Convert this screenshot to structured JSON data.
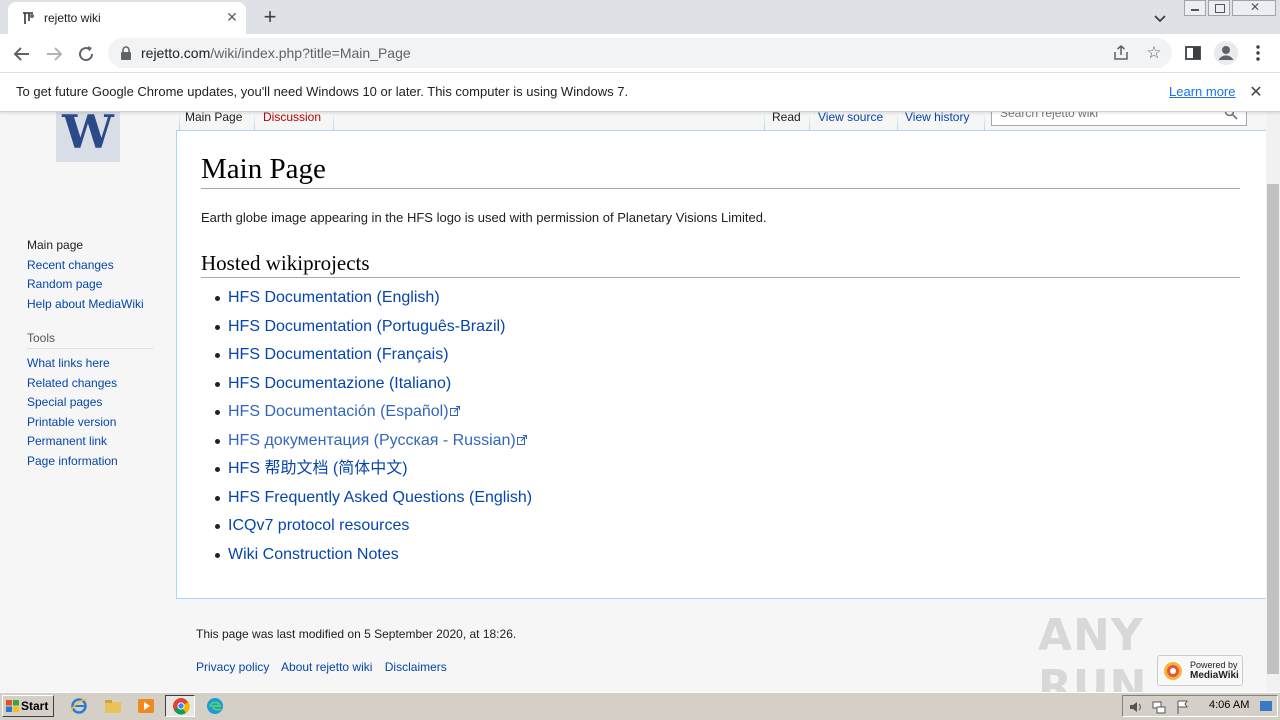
{
  "browser": {
    "tab_title": "rejetto wiki",
    "url_host": "rejetto.com",
    "url_path": "/wiki/index.php?title=Main_Page",
    "infobar_text": "To get future Google Chrome updates, you'll need Windows 10 or later. This computer is using Windows 7.",
    "infobar_link": "Learn more"
  },
  "wiki": {
    "tabs": {
      "main_page": "Main Page",
      "discussion": "Discussion",
      "read": "Read",
      "view_source": "View source",
      "view_history": "View history"
    },
    "search_placeholder": "Search rejetto wiki",
    "navigation": [
      "Main page",
      "Recent changes",
      "Random page",
      "Help about MediaWiki"
    ],
    "tools_heading": "Tools",
    "tools": [
      "What links here",
      "Related changes",
      "Special pages",
      "Printable version",
      "Permanent link",
      "Page information"
    ],
    "heading": "Main Page",
    "intro": "Earth globe image appearing in the HFS logo is used with permission of Planetary Visions Limited.",
    "section_heading": "Hosted wikiprojects",
    "projects": [
      {
        "label": "HFS Documentation (English)",
        "external": false
      },
      {
        "label": "HFS Documentation (Português-Brazil)",
        "external": false
      },
      {
        "label": "HFS Documentation (Français)",
        "external": false
      },
      {
        "label": "HFS Documentazione (Italiano)",
        "external": false
      },
      {
        "label": "HFS Documentación (Español)",
        "external": true
      },
      {
        "label": "HFS документация (Русская - Russian)",
        "external": true
      },
      {
        "label": "HFS 帮助文档 (简体中文)",
        "external": false
      },
      {
        "label": "HFS Frequently Asked Questions (English)",
        "external": false
      },
      {
        "label": "ICQv7 protocol resources",
        "external": false
      },
      {
        "label": "Wiki Construction Notes",
        "external": false
      }
    ],
    "last_modified": "This page was last modified on 5 September 2020, at 18:26.",
    "footer_links": [
      "Privacy policy",
      "About rejetto wiki",
      "Disclaimers"
    ],
    "powered_by_line1": "Powered by",
    "powered_by_line2": "MediaWiki",
    "logo_letter": "W"
  },
  "watermark": "ANY RUN",
  "taskbar": {
    "start_label": "Start",
    "clock": "4:06 AM"
  },
  "colors": {
    "link": "#0645ad",
    "external_link": "#3366bb",
    "new_link": "#ba0000",
    "chrome_accent": "#1a73e8"
  }
}
